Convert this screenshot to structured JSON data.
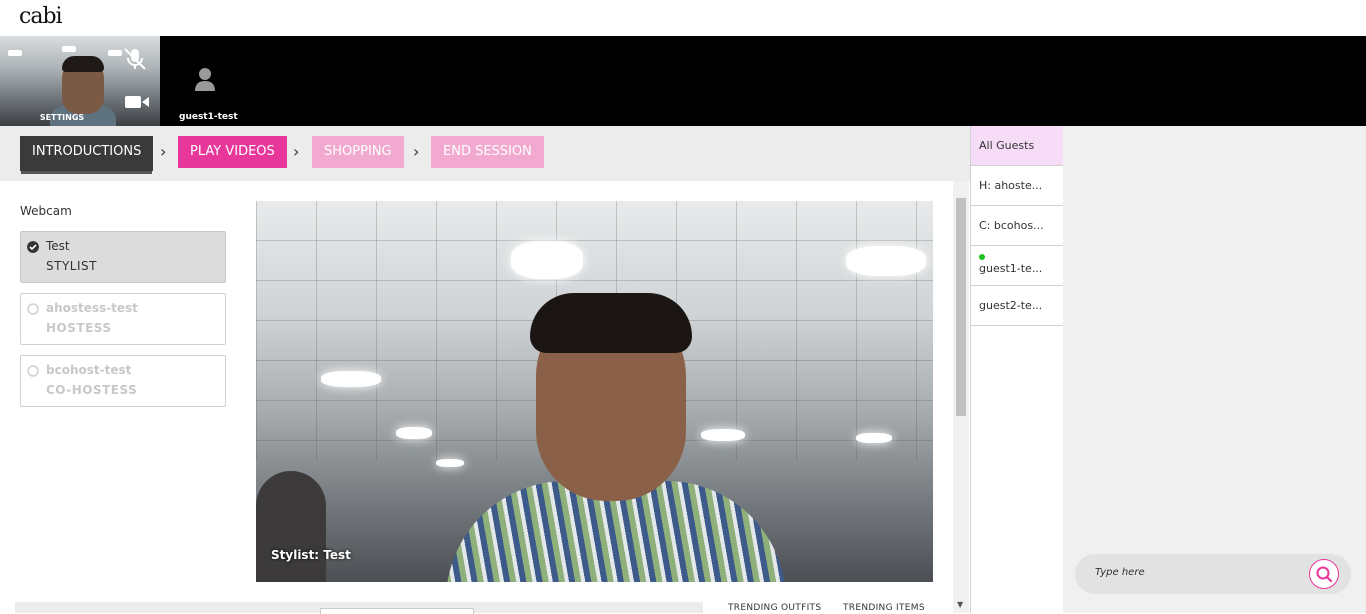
{
  "app": {
    "logo": "cabi"
  },
  "video_bar": {
    "self_tile_label": "SETTINGS",
    "guest_tile_label": "guest1-test"
  },
  "steps": [
    {
      "label": "INTRODUCTIONS",
      "state": "active"
    },
    {
      "label": "PLAY VIDEOS",
      "state": "enabled"
    },
    {
      "label": "SHOPPING",
      "state": "disabled"
    },
    {
      "label": "END SESSION",
      "state": "disabled"
    }
  ],
  "webcam": {
    "title": "Webcam",
    "options": [
      {
        "name": "Test",
        "role": "STYLIST",
        "selected": true
      },
      {
        "name": "ahostess-test",
        "role": "HOSTESS",
        "selected": false
      },
      {
        "name": "bcohost-test",
        "role": "CO-HOSTESS",
        "selected": false
      }
    ]
  },
  "video": {
    "caption": "Stylist: Test"
  },
  "trending": {
    "outfits_label": "TRENDING OUTFITS",
    "items_label": "TRENDING ITEMS"
  },
  "guests": [
    {
      "label": "All Guests",
      "online": false
    },
    {
      "label": "H: ahoste...",
      "online": false
    },
    {
      "label": "C: bcohos...",
      "online": false
    },
    {
      "label": "guest1-te...",
      "online": true
    },
    {
      "label": "guest2-te...",
      "online": false
    }
  ],
  "chat": {
    "placeholder": "Type here"
  },
  "colors": {
    "accent": "#e8379b",
    "accent_faded": "#f2a9cf",
    "online": "#1cc11c",
    "active_step": "#3a3a3a"
  }
}
